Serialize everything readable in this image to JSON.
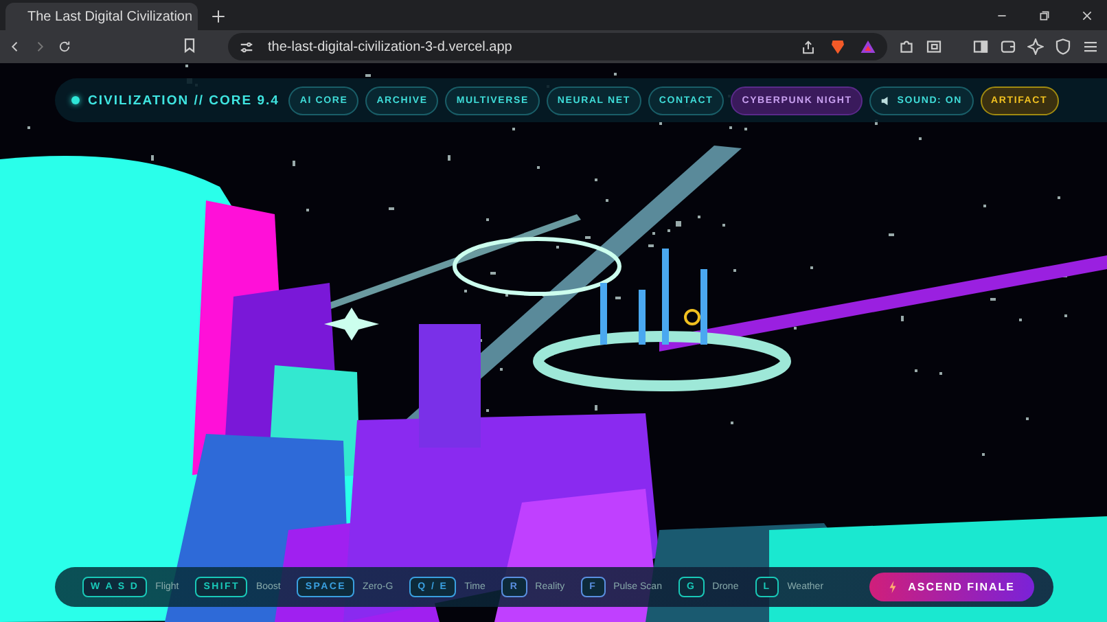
{
  "browser": {
    "tab": {
      "title": "The Last Digital Civilization",
      "selected": true
    },
    "address": "the-last-digital-civilization-3-d.vercel.app"
  },
  "nav": {
    "brand": "CIVILIZATION // CORE 9.4",
    "links": [
      {
        "label": "AI CORE"
      },
      {
        "label": "ARCHIVE"
      },
      {
        "label": "MULTIVERSE"
      },
      {
        "label": "NEURAL NET"
      },
      {
        "label": "CONTACT"
      }
    ],
    "theme": "CYBERPUNK NIGHT",
    "sound": "SOUND: ON",
    "artifact": "ARTIFACT"
  },
  "controls": [
    {
      "key": "W A S D",
      "label": "Flight",
      "color": "#19c9b8"
    },
    {
      "key": "SHIFT",
      "label": "Boost",
      "color": "#19c9b8"
    },
    {
      "key": "SPACE",
      "label": "Zero-G",
      "color": "#3aa0e0"
    },
    {
      "key": "Q / E",
      "label": "Time",
      "color": "#3aa0e0"
    },
    {
      "key": "R",
      "label": "Reality",
      "color": "#5a8fe0"
    },
    {
      "key": "F",
      "label": "Pulse Scan",
      "color": "#5a8fe0"
    },
    {
      "key": "G",
      "label": "Drone",
      "color": "#19c9b8"
    },
    {
      "key": "L",
      "label": "Weather",
      "color": "#19c9b8"
    }
  ],
  "finale": "ASCEND FINALE"
}
